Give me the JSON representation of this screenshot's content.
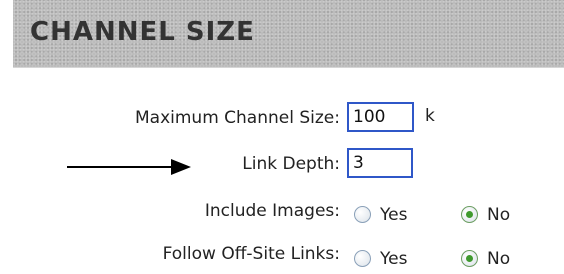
{
  "section": {
    "title": "CHANNEL SIZE"
  },
  "form": {
    "max_channel_size": {
      "label": "Maximum Channel Size:",
      "value": "100",
      "unit": "k"
    },
    "link_depth": {
      "label": "Link Depth:",
      "value": "3"
    },
    "include_images": {
      "label": "Include Images:",
      "options": [
        "Yes",
        "No"
      ],
      "selected": "No"
    },
    "follow_offsite_links": {
      "label": "Follow Off-Site Links:",
      "options": [
        "Yes",
        "No"
      ],
      "selected": "No"
    }
  },
  "icons": {
    "pointer": "right-arrow-icon"
  }
}
